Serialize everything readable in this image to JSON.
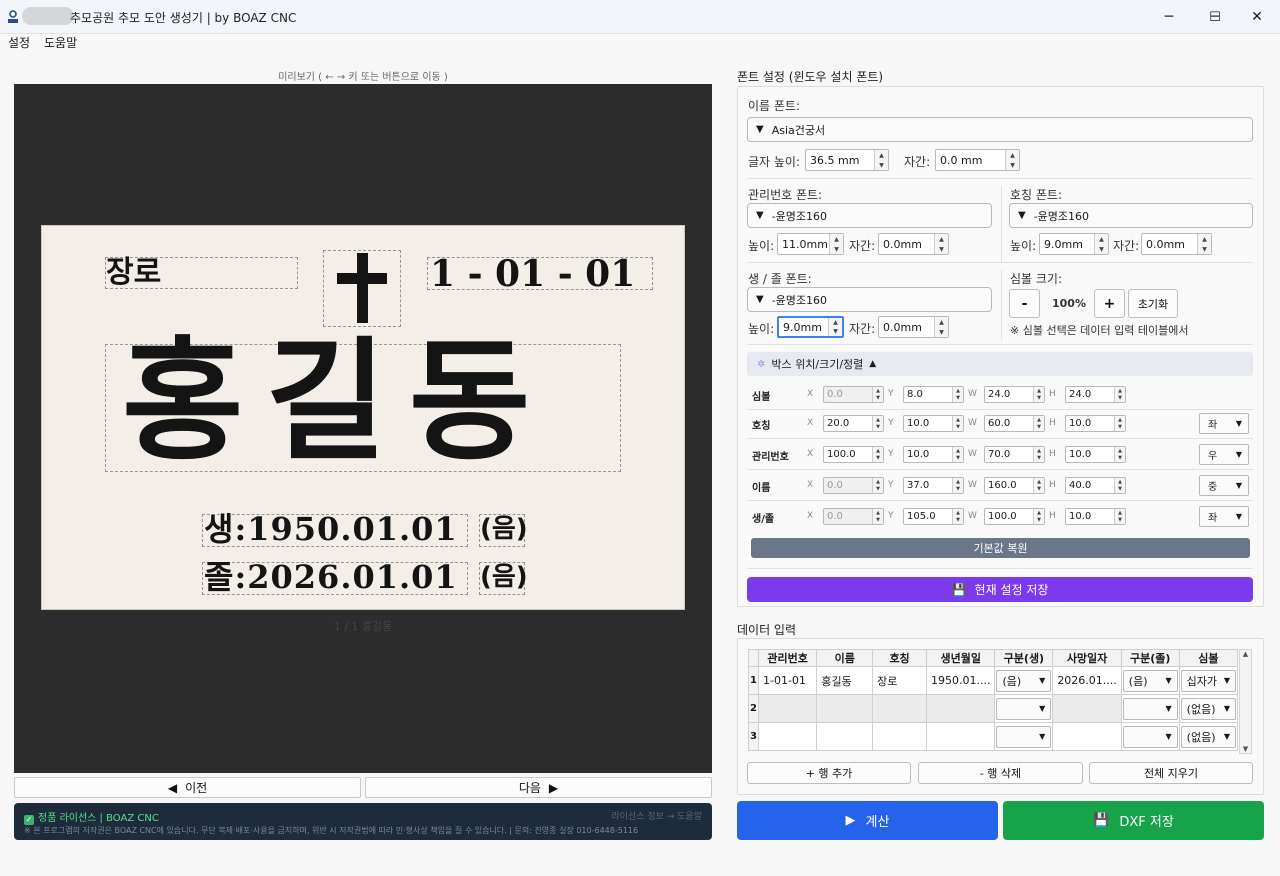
{
  "window": {
    "title": "추모공원 추모 도안 생성기  |  by BOAZ CNC",
    "minimize": "─",
    "maximize": "☐",
    "close": "✕"
  },
  "menu": {
    "items": [
      "설정",
      "도움말"
    ]
  },
  "preview": {
    "caption": "미리보기  ( ← → 키 또는 버튼으로 이동 )",
    "plate": {
      "title_text": "장로",
      "symbol": "✝",
      "number": "1 - 01 - 01",
      "name": "홍길동",
      "birth": "생:1950.01.01",
      "birth_tag": "(음)",
      "death": "졸:2026.01.01",
      "death_tag": "(음)"
    },
    "page_label": "1 / 1   홍길동",
    "prev_label": "이전",
    "next_label": "다음"
  },
  "license": {
    "line1": "정품 라이선스  |  BOAZ CNC",
    "link": "라이선스 정보 → 도움말",
    "line2": "※ 본 프로그램의 저작권은 BOAZ CNC에 있습니다. 무단 복제·배포·사용을 금지하며, 위반 시 저작권법에 따라 민·형사상 책임을 질 수 있습니다. | 문의: 진영종 실장 010-6448-5116"
  },
  "font_settings": {
    "section_title": "폰트 설정  (윈도우 설치 폰트)",
    "name_font_label": "이름 폰트:",
    "name_font": "Asia건궁서",
    "char_height_label": "글자 높이:",
    "char_height": "36.5 mm",
    "spacing_label": "자간:",
    "spacing": "0.0 mm",
    "mgmt_font_label": "관리번호 폰트:",
    "mgmt_font": "-윤명조160",
    "mgmt_height_label": "높이:",
    "mgmt_height": "11.0mm",
    "mgmt_spacing_label": "자간:",
    "mgmt_spacing": "0.0mm",
    "title_font_label": "호칭 폰트:",
    "title_font": "-윤명조160",
    "title_height_label": "높이:",
    "title_height": "9.0mm",
    "title_spacing_label": "자간:",
    "title_spacing": "0.0mm",
    "date_font_label": "생 / 졸 폰트:",
    "date_font": "-윤명조160",
    "date_height_label": "높이:",
    "date_height": "9.0mm",
    "date_spacing_label": "자간:",
    "date_spacing": "0.0mm",
    "symbol_size_label": "심볼 크기:",
    "symbol_minus": "-",
    "symbol_pct": "100%",
    "symbol_plus": "+",
    "symbol_reset": "초기화",
    "symbol_note": "※ 심볼 선택은 데이터 입력 테이블에서",
    "box_header": "박스 위치/크기/정렬",
    "box_header_arrow": "▲",
    "box_rows": [
      {
        "label": "심볼",
        "x": "0.0",
        "y": "8.0",
        "w": "24.0",
        "h": "24.0",
        "x_disabled": true,
        "align": ""
      },
      {
        "label": "호칭",
        "x": "20.0",
        "y": "10.0",
        "w": "60.0",
        "h": "10.0",
        "x_disabled": false,
        "align": "좌"
      },
      {
        "label": "관리번호",
        "x": "100.0",
        "y": "10.0",
        "w": "70.0",
        "h": "10.0",
        "x_disabled": false,
        "align": "우"
      },
      {
        "label": "이름",
        "x": "0.0",
        "y": "37.0",
        "w": "160.0",
        "h": "40.0",
        "x_disabled": true,
        "align": "중"
      },
      {
        "label": "생/졸",
        "x": "0.0",
        "y": "105.0",
        "w": "100.0",
        "h": "10.0",
        "x_disabled": true,
        "align": "좌"
      }
    ],
    "axis_x": "X",
    "axis_y": "Y",
    "axis_w": "W",
    "axis_h": "H",
    "restore_label": "기본값 복원",
    "save_label": "현재 설정 저장"
  },
  "data_input": {
    "section_title": "데이터 입력",
    "columns": [
      "관리번호",
      "이름",
      "호칭",
      "생년월일",
      "구분(생)",
      "사망일자",
      "구분(졸)",
      "심볼"
    ],
    "rows": [
      {
        "num": "1",
        "mgmt": "1-01-01",
        "name": "홍길동",
        "title": "장로",
        "birth": "1950.01....",
        "birth_tag": "(음)",
        "death": "2026.01....",
        "death_tag": "(음)",
        "symbol": "십자가"
      },
      {
        "num": "2",
        "mgmt": "",
        "name": "",
        "title": "",
        "birth": "",
        "birth_tag": "",
        "death": "",
        "death_tag": "",
        "symbol": "(없음)"
      },
      {
        "num": "3",
        "mgmt": "",
        "name": "",
        "title": "",
        "birth": "",
        "birth_tag": "",
        "death": "",
        "death_tag": "",
        "symbol": "(없음)"
      }
    ],
    "add_row": "+ 행 추가",
    "delete_row": "- 행 삭제",
    "clear_all": "전체 지우기"
  },
  "actions": {
    "calc": "계산",
    "dxf": "DXF 저장"
  },
  "colors": {
    "accent_purple": "#7c3aed",
    "calc_blue": "#2563eb",
    "dxf_green": "#16a34a",
    "restore_grey": "#6b7789",
    "license_bg": "#1e2b3a"
  }
}
